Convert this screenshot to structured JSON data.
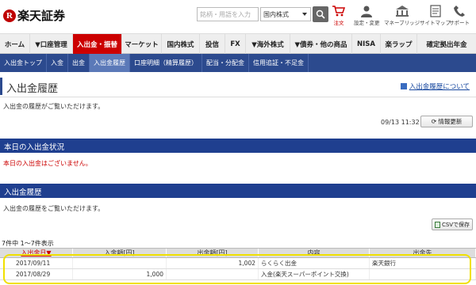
{
  "brand": {
    "text": "楽天証券",
    "r": "R"
  },
  "search": {
    "placeholder": "銘柄・用語を入力",
    "category": "国内株式"
  },
  "header_icons": [
    {
      "label": "注文",
      "icon": "cart-icon"
    },
    {
      "label": "設定・変更",
      "icon": "person-icon"
    },
    {
      "label": "マネーブリッジ",
      "icon": "bank-icon"
    },
    {
      "label": "サイトマップ",
      "icon": "sitemap-icon"
    },
    {
      "label": "サポート",
      "icon": "phone-icon"
    }
  ],
  "main_nav": [
    "ホーム",
    "▼口座管理",
    "入出金・振替",
    "マーケット",
    "国内株式",
    "投信",
    "FX",
    "▼海外株式",
    "▼債券・他の商品",
    "NISA",
    "楽ラップ",
    "確定拠出年金"
  ],
  "main_nav_active": "入出金・振替",
  "sub_nav": [
    "入出金トップ",
    "入金",
    "出金",
    "入出金履歴",
    "口座明細（精算履歴）",
    "配当・分配金",
    "信用追証・不足金"
  ],
  "sub_nav_active": "入出金履歴",
  "page": {
    "title": "入出金履歴",
    "help_link": "入出金履歴について",
    "description": "入出金の履歴がご覧いただけます。",
    "timestamp": "09/13 11:32",
    "refresh_label": "情報更新"
  },
  "today_section": {
    "title": "本日の入出金状況",
    "message": "本日の入出金はございません。"
  },
  "history_section": {
    "title": "入出金履歴",
    "description": "入出金の履歴をご覧いただけます。",
    "csv_label": "CSVで保存",
    "count_text": "7件中 1〜7件表示"
  },
  "table": {
    "headers": [
      "入出金日▼",
      "入金額[円]",
      "出金額[円]",
      "内容",
      "出金先"
    ],
    "rows": [
      [
        "2017/09/11",
        "",
        "1,002",
        "らくらく出金",
        "楽天銀行"
      ],
      [
        "2017/08/29",
        "1,000",
        "",
        "入金(楽天スーパーポイント交換)",
        ""
      ]
    ]
  },
  "colors": {
    "accent": "#cc0000",
    "nav": "#2c4a8e",
    "section": "#1f3f8f",
    "highlight": "#f0e000"
  }
}
